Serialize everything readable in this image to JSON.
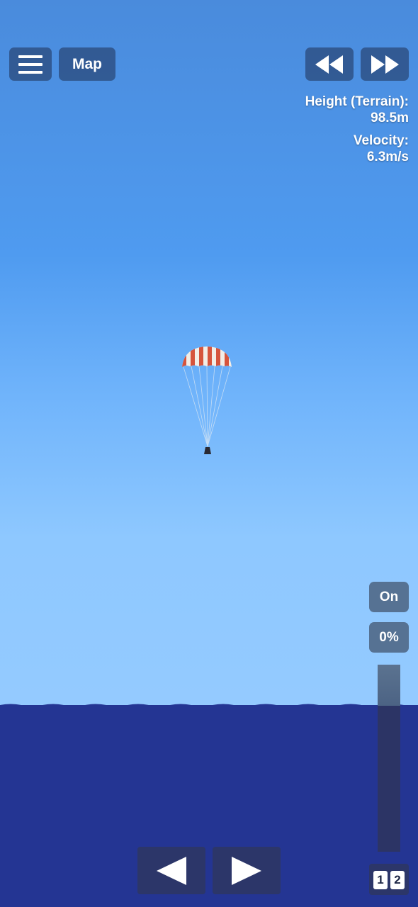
{
  "top_bar": {
    "menu_icon": "hamburger-menu-icon",
    "map_label": "Map",
    "rewind_icon": "rewind-icon",
    "fast_forward_icon": "fast-forward-icon"
  },
  "telemetry": {
    "height_label": "Height (Terrain):",
    "height_value": "98.5m",
    "velocity_label": "Velocity:",
    "velocity_value": "6.3m/s"
  },
  "right_panel": {
    "toggle_label": "On",
    "throttle_label": "0%",
    "throttle_level": 0
  },
  "bottom_controls": {
    "left_icon": "rotate-left-arrow-icon",
    "right_icon": "rotate-right-arrow-icon",
    "stage_key_1": "1",
    "stage_key_2": "2"
  },
  "colors": {
    "sky_top": "#4a8bdc",
    "sky_bottom": "#94caff",
    "sea": "#243593",
    "button": "#2c4c7d",
    "parachute_red": "#d6543c",
    "parachute_white": "#f3ede6"
  }
}
